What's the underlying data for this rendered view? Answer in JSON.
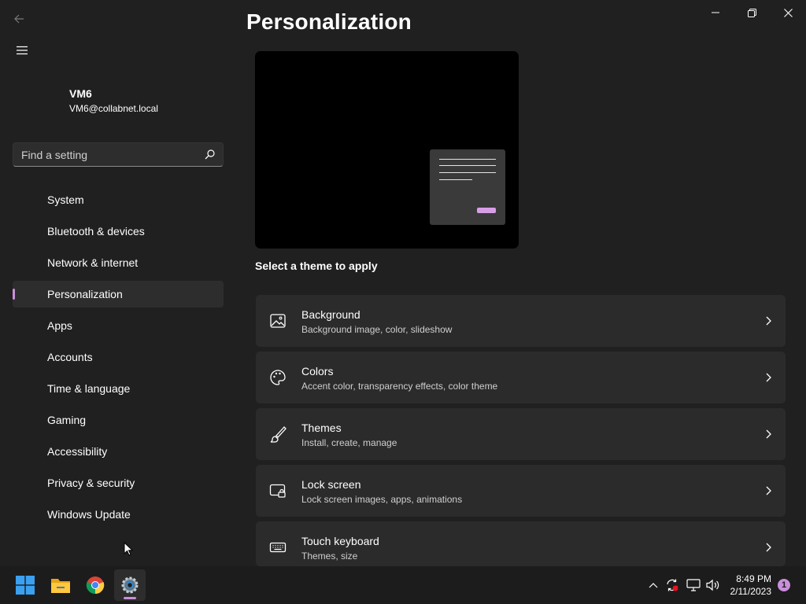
{
  "window": {
    "page_title": "Personalization"
  },
  "user": {
    "name": "VM6",
    "email": "VM6@collabnet.local"
  },
  "search": {
    "placeholder": "Find a setting"
  },
  "sidebar": {
    "items": [
      {
        "label": "System"
      },
      {
        "label": "Bluetooth & devices"
      },
      {
        "label": "Network & internet"
      },
      {
        "label": "Personalization",
        "active": true
      },
      {
        "label": "Apps"
      },
      {
        "label": "Accounts"
      },
      {
        "label": "Time & language"
      },
      {
        "label": "Gaming"
      },
      {
        "label": "Accessibility"
      },
      {
        "label": "Privacy & security"
      },
      {
        "label": "Windows Update"
      }
    ]
  },
  "main": {
    "section_heading": "Select a theme to apply",
    "cards": [
      {
        "title": "Background",
        "subtitle": "Background image, color, slideshow",
        "icon": "image-icon"
      },
      {
        "title": "Colors",
        "subtitle": "Accent color, transparency effects, color theme",
        "icon": "palette-icon"
      },
      {
        "title": "Themes",
        "subtitle": "Install, create, manage",
        "icon": "brush-icon"
      },
      {
        "title": "Lock screen",
        "subtitle": "Lock screen images, apps, animations",
        "icon": "lock-screen-icon"
      },
      {
        "title": "Touch keyboard",
        "subtitle": "Themes, size",
        "icon": "keyboard-icon"
      }
    ]
  },
  "taskbar": {
    "apps": [
      "start-icon",
      "file-explorer-icon",
      "chrome-icon",
      "settings-icon"
    ],
    "clock_time": "8:49 PM",
    "clock_date": "2/11/2023",
    "notification_count": "1"
  },
  "colors": {
    "accent": "#c98fda",
    "background": "#202020",
    "card": "#2b2b2b"
  }
}
